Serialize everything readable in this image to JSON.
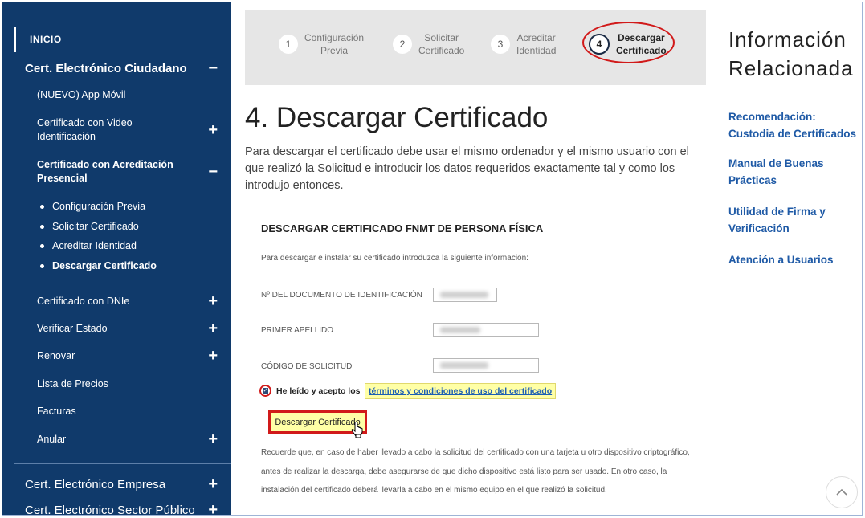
{
  "sidebar": {
    "inicio": "INICIO",
    "ciudadano": "Cert. Electrónico Ciudadano",
    "app_movil": "(NUEVO) App Móvil",
    "video_1": "Certificado con Video",
    "video_2": "Identificación",
    "acreditacion_1": "Certificado con Acreditación",
    "acreditacion_2": "Presencial",
    "sub_items": [
      "Configuración Previa",
      "Solicitar Certificado",
      "Acreditar Identidad",
      "Descargar Certificado"
    ],
    "dnie": "Certificado con DNIe",
    "verificar": "Verificar Estado",
    "renovar": "Renovar",
    "precios": "Lista de Precios",
    "facturas": "Facturas",
    "anular": "Anular",
    "empresa": "Cert. Electrónico Empresa",
    "sector_publico": "Cert. Electrónico Sector Público",
    "plus": "+",
    "minus": "−"
  },
  "stepper": {
    "steps": [
      {
        "num": "1",
        "line1": "Configuración",
        "line2": "Previa"
      },
      {
        "num": "2",
        "line1": "Solicitar",
        "line2": "Certificado"
      },
      {
        "num": "3",
        "line1": "Acreditar",
        "line2": "Identidad"
      },
      {
        "num": "4",
        "line1": "Descargar",
        "line2": "Certificado"
      }
    ]
  },
  "main": {
    "title": "4. Descargar Certificado",
    "intro": "Para descargar el certificado debe usar el mismo ordenador y el mismo usuario con el que realizó la Solicitud e introducir los datos requeridos exactamente tal y como los introdujo entonces.",
    "form_title": "DESCARGAR CERTIFICADO FNMT DE PERSONA FÍSICA",
    "form_desc": "Para descargar e instalar su certificado introduzca la siguiente información:",
    "field_doc": "Nº DEL DOCUMENTO DE IDENTIFICACIÓN",
    "field_apellido": "PRIMER APELLIDO",
    "field_codigo": "CÓDIGO DE SOLICITUD",
    "accept_text": "He leído y acepto los",
    "terms_link": "términos y condiciones de uso del certificado",
    "download_button": "Descargar Certificado",
    "recuerde": "Recuerde que, en caso de haber llevado a cabo la solicitud del certificado con una tarjeta u otro dispositivo criptográfico, antes de realizar la descarga, debe asegurarse de que dicho dispositivo está listo para ser usado. En otro caso, la instalación del certificado deberá llevarla a cabo en el mismo equipo en el que realizó la solicitud."
  },
  "related": {
    "title_1": "Información",
    "title_2": "Relacionada",
    "links": [
      {
        "l1": "Recomendación:",
        "l2": "Custodia de Certificados"
      },
      {
        "l1": "Manual de Buenas",
        "l2": "Prácticas"
      },
      {
        "l1": "Utilidad de Firma y",
        "l2": "Verificación"
      },
      {
        "l1": "Atención a Usuarios",
        "l2": ""
      }
    ]
  },
  "icons": {
    "plus": "plus-icon",
    "minus": "minus-icon",
    "check": "checkbox-checked-icon",
    "cursor": "hand-cursor-icon",
    "scroll_top": "chevron-up-icon"
  },
  "colors": {
    "sidebar_bg": "#103a6b",
    "highlight_red": "#d11a1a",
    "link_blue": "#1f5aa6",
    "highlight_yellow": "#ffffa6"
  }
}
